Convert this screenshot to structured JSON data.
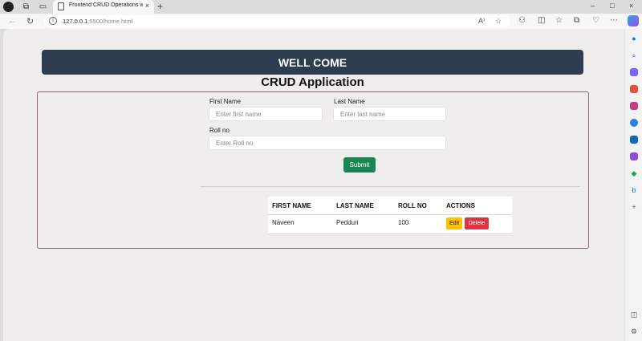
{
  "browser": {
    "tab_title": "Frontend CRUD Operations with",
    "tab_close": "×",
    "new_tab": "+",
    "url_host": "127.0.0.1",
    "url_rest": ":5500/home.html",
    "minimize": "–",
    "maximize": "□",
    "close": "×"
  },
  "page": {
    "banner": "WELL COME",
    "title": "CRUD Application"
  },
  "form": {
    "first_name_label": "First Name",
    "first_name_placeholder": "Enter first name",
    "last_name_label": "Last Name",
    "last_name_placeholder": "Enter last name",
    "roll_label": "Roll no",
    "roll_placeholder": "Enter Roll no",
    "submit_label": "Submit"
  },
  "table": {
    "headers": [
      "FIRST NAME",
      "LAST NAME",
      "ROLL NO",
      "ACTIONS"
    ],
    "rows": [
      {
        "first_name": "Naveen",
        "last_name": "Pedduri",
        "roll_no": "100",
        "edit_label": "Edit",
        "delete_label": "Delete"
      }
    ]
  },
  "colors": {
    "banner_bg": "#2c3e50",
    "submit_bg": "#198754",
    "edit_bg": "#ffc107",
    "delete_bg": "#dc3545"
  }
}
